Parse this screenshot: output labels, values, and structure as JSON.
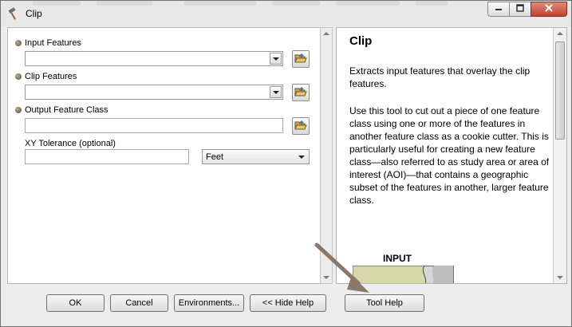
{
  "window": {
    "title": "Clip"
  },
  "params": {
    "input_features": {
      "label": "Input Features",
      "value": ""
    },
    "clip_features": {
      "label": "Clip Features",
      "value": ""
    },
    "output_feature_class": {
      "label": "Output Feature Class",
      "value": ""
    },
    "xy_tolerance": {
      "label": "XY Tolerance (optional)",
      "value": "",
      "unit": "Feet"
    }
  },
  "help": {
    "title": "Clip",
    "summary": "Extracts input features that overlay the clip features.",
    "description": "Use this tool to cut out a piece of one feature class using one or more of the features in another feature class as a cookie cutter. This is particularly useful for creating a new feature class—also referred to as study area or area of interest (AOI)—that contains a geographic subset of the features in another, larger feature class.",
    "diagram_label": "INPUT"
  },
  "buttons": {
    "ok": "OK",
    "cancel": "Cancel",
    "environments": "Environments...",
    "hide_help": "<< Hide Help",
    "tool_help": "Tool Help"
  },
  "icons": [
    "hammer-icon",
    "minimize-icon",
    "maximize-icon",
    "close-icon",
    "open-folder-icon",
    "dropdown-arrow-icon"
  ]
}
